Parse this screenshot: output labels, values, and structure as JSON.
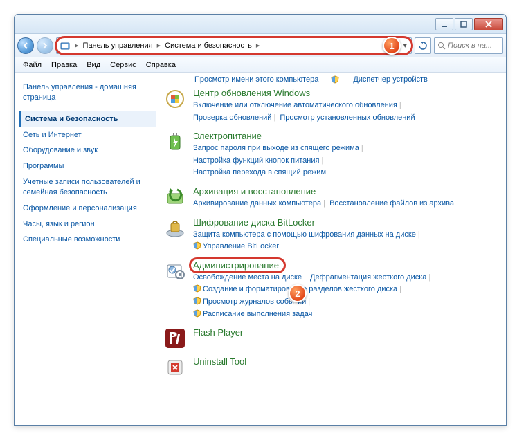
{
  "markers": {
    "one": "1",
    "two": "2"
  },
  "titlebar": {},
  "address": {
    "seg1": "Панель управления",
    "seg2": "Система и безопасность",
    "sep": "▸"
  },
  "search": {
    "placeholder": "Поиск в па..."
  },
  "menu": {
    "file": "Файл",
    "edit": "Правка",
    "view": "Вид",
    "tools": "Сервис",
    "help": "Справка"
  },
  "sidebar": {
    "home": "Панель управления - домашняя страница",
    "current": "Система и безопасность",
    "links": [
      "Сеть и Интернет",
      "Оборудование и звук",
      "Программы",
      "Учетные записи пользователей и семейная безопасность",
      "Оформление и персонализация",
      "Часы, язык и регион",
      "Специальные возможности"
    ]
  },
  "top": {
    "left": "Просмотр имени этого компьютера",
    "right": "Диспетчер устройств"
  },
  "cats": [
    {
      "title": "Центр обновления Windows",
      "subs": [
        {
          "t": "Включение или отключение автоматического обновления",
          "s": false
        },
        {
          "t": "Проверка обновлений",
          "s": false
        },
        {
          "t": "Просмотр установленных обновлений",
          "s": false
        }
      ]
    },
    {
      "title": "Электропитание",
      "subs": [
        {
          "t": "Запрос пароля при выходе из спящего режима",
          "s": false
        },
        {
          "t": "Настройка функций кнопок питания",
          "s": false
        },
        {
          "t": "Настройка перехода в спящий режим",
          "s": false
        }
      ]
    },
    {
      "title": "Архивация и восстановление",
      "subs": [
        {
          "t": "Архивирование данных компьютера",
          "s": false
        },
        {
          "t": "Восстановление файлов из архива",
          "s": false
        }
      ]
    },
    {
      "title": "Шифрование диска BitLocker",
      "subs": [
        {
          "t": "Защита компьютера с помощью шифрования данных на диске",
          "s": false
        },
        {
          "t": "Управление BitLocker",
          "s": true
        }
      ]
    },
    {
      "title": "Администрирование",
      "subs": [
        {
          "t": "Освобождение места на диске",
          "s": false
        },
        {
          "t": "Дефрагментация жесткого диска",
          "s": false
        },
        {
          "t": "Создание и форматирование разделов жесткого диска",
          "s": true
        },
        {
          "t": "Просмотр журналов событий",
          "s": true
        },
        {
          "t": "Расписание выполнения задач",
          "s": true
        }
      ]
    },
    {
      "title": "Flash Player",
      "subs": []
    },
    {
      "title": "Uninstall Tool",
      "subs": []
    }
  ]
}
